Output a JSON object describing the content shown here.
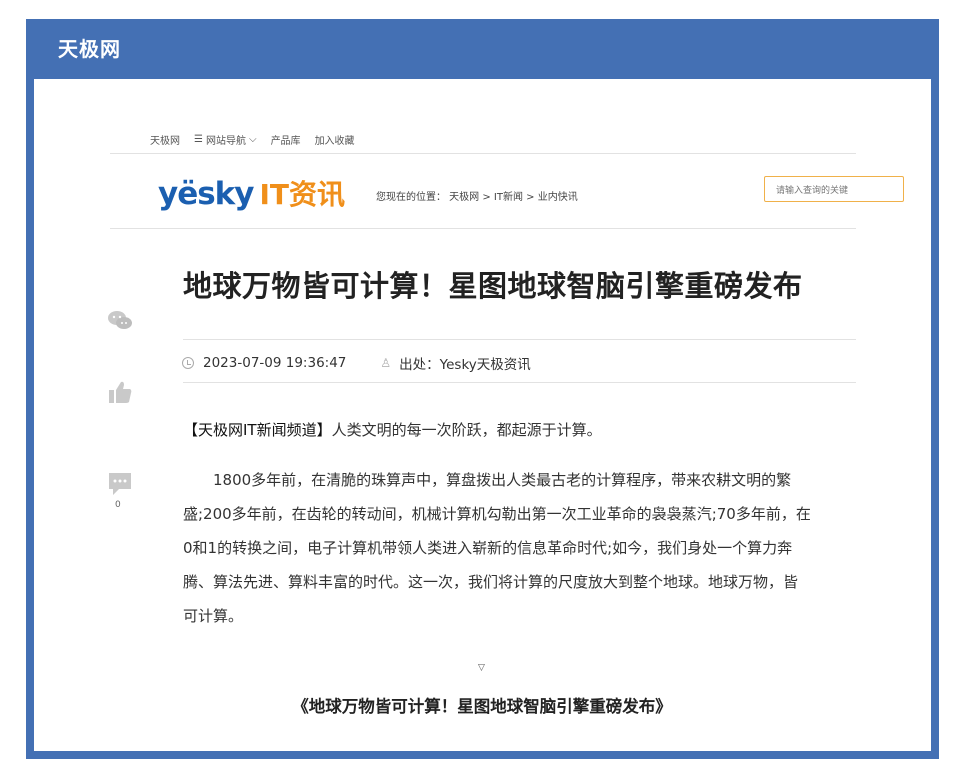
{
  "frame": {
    "title": "天极网"
  },
  "topnav": {
    "items": [
      "天极网",
      "网站导航",
      "产品库",
      "加入收藏"
    ]
  },
  "logo": {
    "brand": "yësky",
    "section": "IT资讯"
  },
  "breadcrumb": "您现在的位置： 天极网 > IT新闻 > 业内快讯",
  "search": {
    "placeholder": "请输入查询的关键"
  },
  "article": {
    "title": "地球万物皆可计算！星图地球智脑引擎重磅发布",
    "datetime": "2023-07-09 19:36:47",
    "source": "出处：Yesky天极资讯",
    "lead_strong": "【天极网IT新闻频道】",
    "lead_rest": "人类文明的每一次阶跃，都起源于计算。",
    "body_lines": [
      "1800多年前，在清脆的珠算声中，算盘拨出人类最古老的计算程序，带来农耕文明的繁",
      "盛;200多年前，在齿轮的转动间，机械计算机勾勒出第一次工业革命的袅袅蒸汽;70多年前，在",
      "0和1的转换之间，电子计算机带领人类进入崭新的信息革命时代;如今，我们身处一个算力奔",
      "腾、算法先进、算料丰富的时代。这一次，我们将计算的尺度放大到整个地球。地球万物，皆",
      "可计算。"
    ]
  },
  "share": {
    "comment_count": "0"
  },
  "caret": "▽",
  "caption": "《地球万物皆可计算！星图地球智脑引擎重磅发布》",
  "colors": {
    "frame": "#4470b4",
    "brand_blue": "#1b5fb0",
    "brand_orange": "#f08f1a",
    "search_border": "#f0b14a"
  }
}
